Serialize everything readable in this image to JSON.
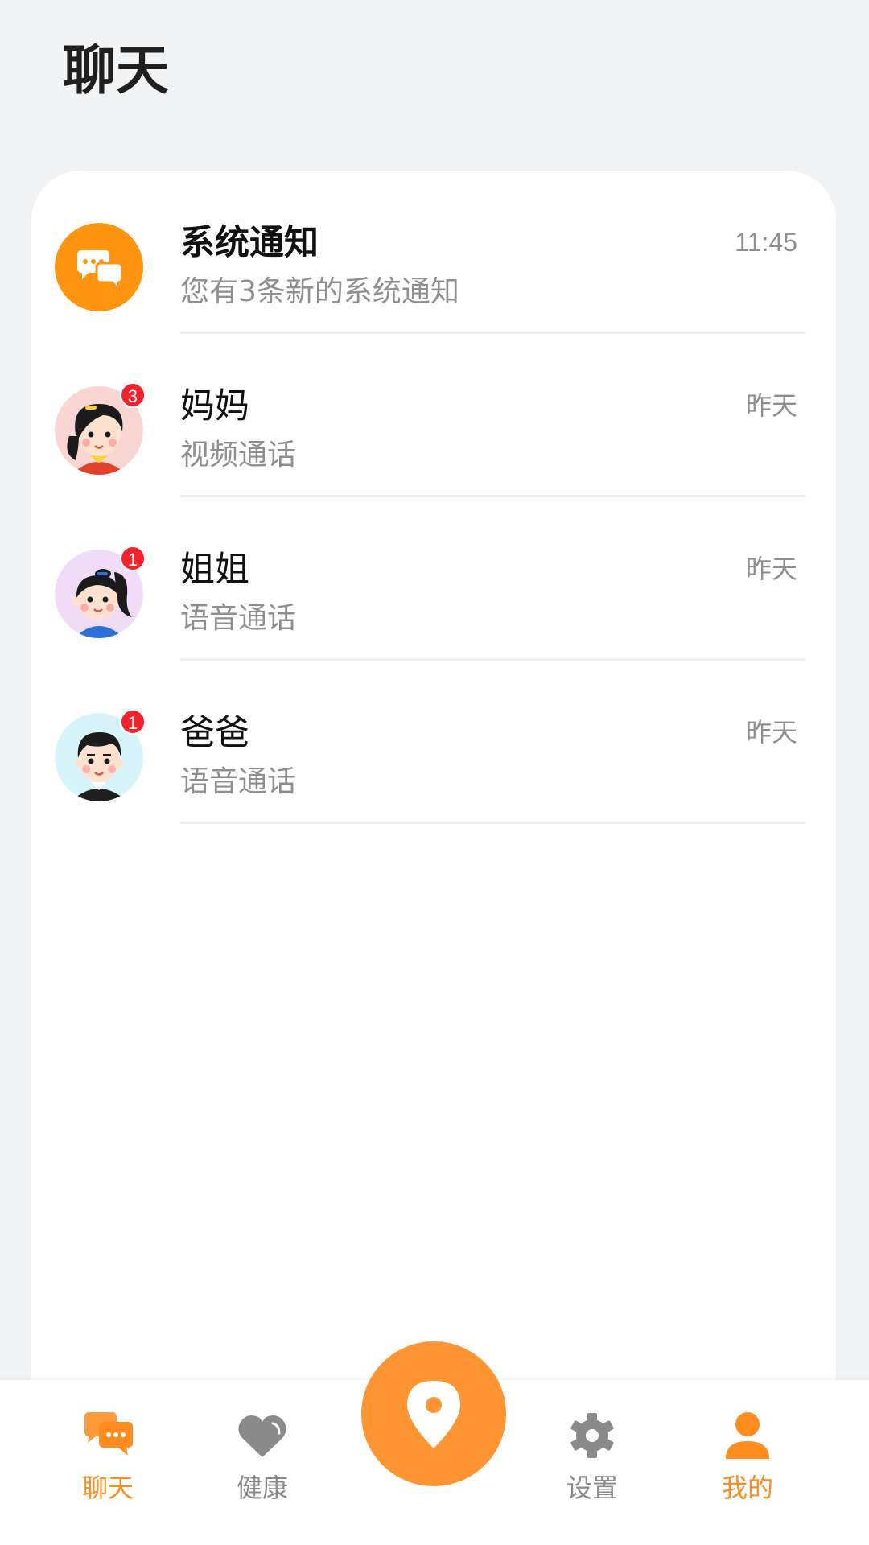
{
  "header": {
    "title": "聊天"
  },
  "conversations": [
    {
      "name": "系统通知",
      "subtitle": "您有3条新的系统通知",
      "time": "11:45",
      "badge": "",
      "avatar_icon": "chat-bubbles-icon"
    },
    {
      "name": "妈妈",
      "subtitle": "视频通话",
      "time": "昨天",
      "badge": "3",
      "avatar_icon": "mom-avatar"
    },
    {
      "name": "姐姐",
      "subtitle": "语音通话",
      "time": "昨天",
      "badge": "1",
      "avatar_icon": "sister-avatar"
    },
    {
      "name": "爸爸",
      "subtitle": "语音通话",
      "time": "昨天",
      "badge": "1",
      "avatar_icon": "dad-avatar"
    }
  ],
  "tabbar": {
    "chat_label": "聊天",
    "health_label": "健康",
    "location_icon": "location-pin-icon",
    "settings_label": "设置",
    "mine_label": "我的"
  },
  "colors": {
    "accent": "#ff8c1f",
    "badge": "#f5222d",
    "background": "#f2f3f5"
  }
}
